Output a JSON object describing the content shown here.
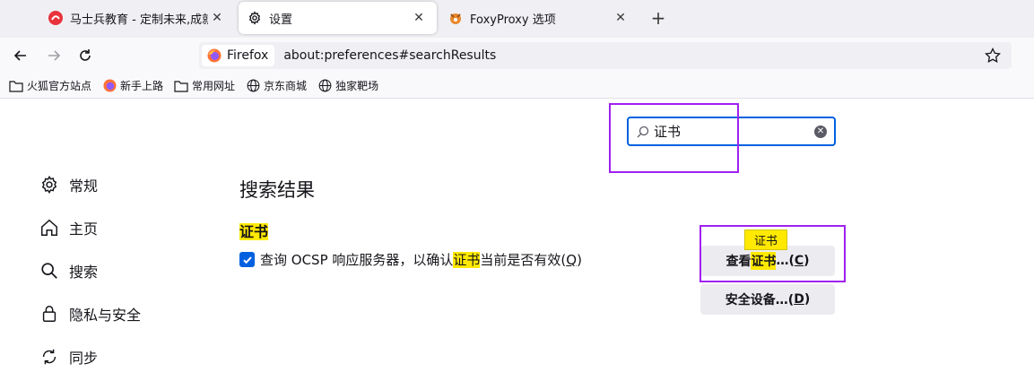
{
  "tabs": [
    {
      "title": "马士兵教育 - 定制未来,成就更好",
      "icon": "mashibing-favicon",
      "active": false
    },
    {
      "title": "设置",
      "icon": "gear-icon",
      "active": true
    },
    {
      "title": "FoxyProxy 选项",
      "icon": "foxyproxy-icon",
      "active": false
    }
  ],
  "urlbar": {
    "identity_label": "Firefox",
    "url": "about:preferences#searchResults"
  },
  "bookmarks": [
    {
      "label": "火狐官方站点",
      "icon": "folder-icon"
    },
    {
      "label": "新手上路",
      "icon": "firefox-icon"
    },
    {
      "label": "常用网址",
      "icon": "folder-icon"
    },
    {
      "label": "京东商城",
      "icon": "globe-icon"
    },
    {
      "label": "独家靶场",
      "icon": "globe-icon"
    }
  ],
  "search": {
    "value": "证书"
  },
  "categories": [
    {
      "label": "常规",
      "icon": "gear-icon"
    },
    {
      "label": "主页",
      "icon": "home-icon"
    },
    {
      "label": "搜索",
      "icon": "search-icon"
    },
    {
      "label": "隐私与安全",
      "icon": "lock-icon"
    },
    {
      "label": "同步",
      "icon": "sync-icon"
    }
  ],
  "results": {
    "title": "搜索结果",
    "group_title": "证书",
    "ocsp": {
      "pre": "查询 OCSP 响应服务器，以确认",
      "highlight": "证书",
      "post": "当前是否有效(",
      "accesskey": "Q",
      "close": ")",
      "checked": true
    },
    "tooltip": "证书",
    "view_cert_button": {
      "pre": "查看",
      "highlight": "证书",
      "post": "…(",
      "accesskey": "C",
      "close": ")"
    },
    "security_devices_button": {
      "pre": "安全设备…(",
      "accesskey": "D",
      "close": ")"
    }
  },
  "colors": {
    "accent": "#0061e0",
    "highlight": "#ffe900",
    "annotation_box": "#a020f0"
  }
}
